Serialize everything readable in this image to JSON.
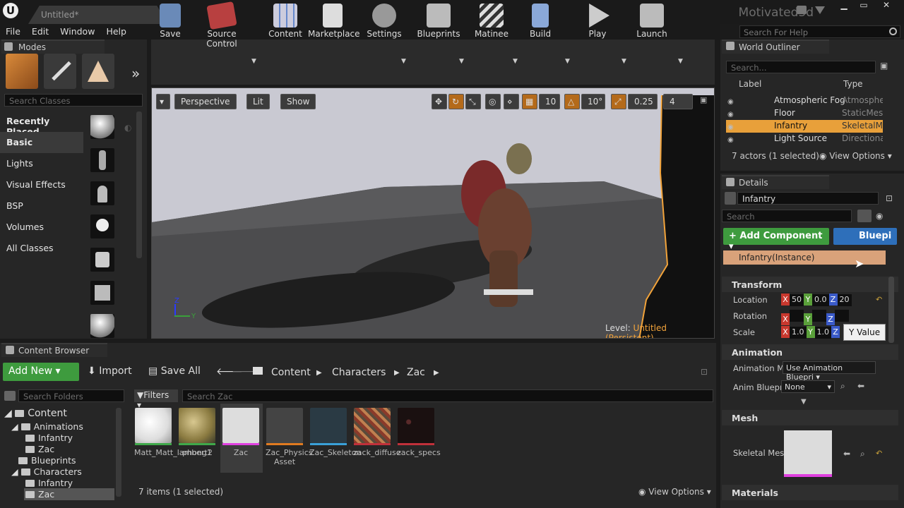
{
  "window": {
    "doc_tab": "Untitled*",
    "project": "Motivated3d"
  },
  "menu": [
    "File",
    "Edit",
    "Window",
    "Help"
  ],
  "help_search": {
    "placeholder": "Search For Help"
  },
  "modes": {
    "tab": "Modes",
    "search_placeholder": "Search Classes",
    "categories": [
      "Recently Placed",
      "Basic",
      "Lights",
      "Visual Effects",
      "BSP",
      "Volumes",
      "All Classes"
    ]
  },
  "toolbar": {
    "buttons": [
      "Save",
      "Source Control",
      "Content",
      "Marketplace",
      "Settings",
      "Blueprints",
      "Matinee",
      "Build",
      "Play",
      "Launch"
    ]
  },
  "viewport": {
    "perspective": "Perspective",
    "lit": "Lit",
    "show": "Show",
    "grid_snap": "10",
    "rot_snap": "10°",
    "scale_snap": "0.25",
    "cam_speed": "4",
    "level_label": "Level:",
    "level_name": "Untitled (Persistent)",
    "axis_z": "Z",
    "axis_y": "Y"
  },
  "outliner": {
    "tab": "World Outliner",
    "search_placeholder": "Search...",
    "col_label": "Label",
    "col_type": "Type",
    "rows": [
      {
        "label": "Atmospheric Fog",
        "type": "Atmospher"
      },
      {
        "label": "Floor",
        "type": "StaticMesh"
      },
      {
        "label": "Infantry",
        "type": "SkeletalMe"
      },
      {
        "label": "Light Source",
        "type": "Directional"
      }
    ],
    "status": "7 actors (1 selected)",
    "view_options": "View Options"
  },
  "details": {
    "tab": "Details",
    "name": "Infantry",
    "search_placeholder": "Search",
    "add_component": "+ Add Component",
    "blueprint": "Bluepi",
    "instance": "Infantry(Instance)",
    "transform": "Transform",
    "location": "Location",
    "rotation": "Rotation",
    "scale": "Scale",
    "loc_values": [
      "50",
      "0.0",
      "20"
    ],
    "scale_values": [
      "1.0",
      "1.0"
    ],
    "tooltip": "Y Value",
    "animation": "Animation",
    "anim_mode_label": "Animation M",
    "anim_mode_value": "Use Animation Bluepri",
    "anim_bp_label": "Anim Bluepri",
    "anim_bp_value": "None",
    "mesh": "Mesh",
    "skeletal_mesh_label": "Skeletal Mes",
    "materials": "Materials"
  },
  "content_browser": {
    "tab": "Content Browser",
    "add_new": "Add New",
    "import": "Import",
    "save_all": "Save All",
    "crumbs": [
      "Content",
      "Characters",
      "Zac"
    ],
    "folder_search": "Search Folders",
    "filters": "Filters",
    "asset_search": "Search Zac",
    "tree": [
      "Content",
      "Animations",
      "Infantry",
      "Zac",
      "Blueprints",
      "Characters",
      "Infantry",
      "Zac"
    ],
    "assets": [
      {
        "name": "Matt_Matt_lambert2",
        "bar": "#3fa84a"
      },
      {
        "name": "phong1",
        "bar": "#3fa84a"
      },
      {
        "name": "Zac",
        "bar": "#e040e0"
      },
      {
        "name": "Zac_Physics Asset",
        "bar": "#e07a20"
      },
      {
        "name": "Zac_Skeleton",
        "bar": "#3aa0d8"
      },
      {
        "name": "zack_diffuse",
        "bar": "#c0303a"
      },
      {
        "name": "zack_specs",
        "bar": "#c0303a"
      }
    ],
    "status": "7 items (1 selected)",
    "view_options": "View Options"
  },
  "colors": {
    "accent_green": "#3e9b3e",
    "selection_orange": "#f2a33a",
    "blueprint_blue": "#2e6fba"
  }
}
